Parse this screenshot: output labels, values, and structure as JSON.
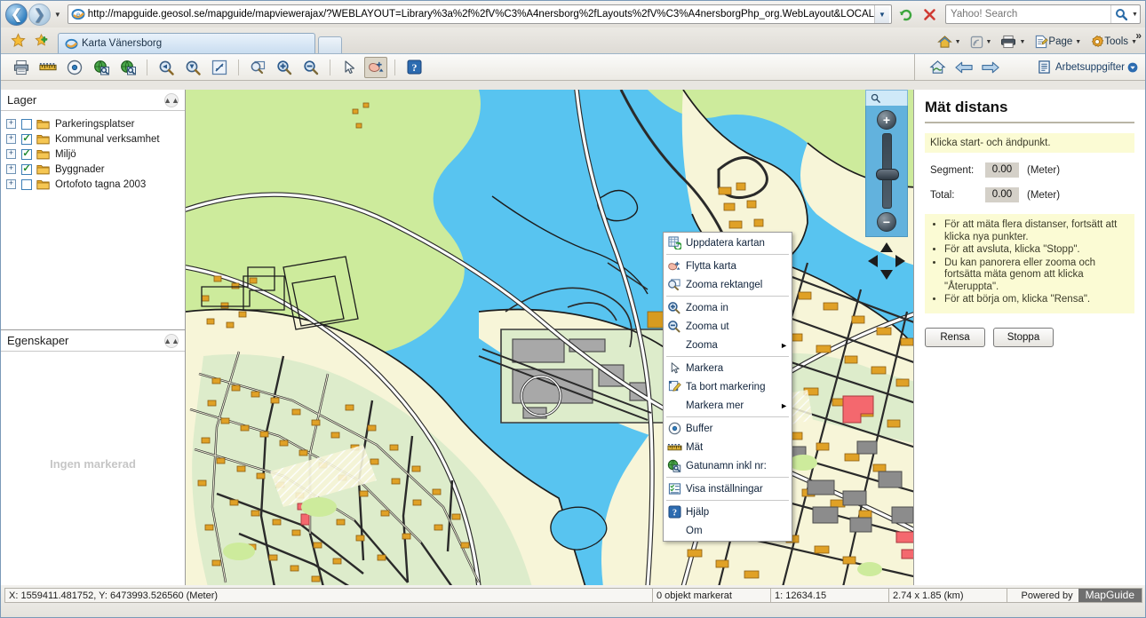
{
  "browser": {
    "url": "http://mapguide.geosol.se/mapguide/mapviewerajax/?WEBLAYOUT=Library%3a%2f%2fV%C3%A4nersborg%2fLayouts%2fV%C3%A4nersborgPhp_org.WebLayout&LOCALE=",
    "search_placeholder": "Yahoo! Search",
    "search_value": "",
    "tab_title": "Karta Vänersborg",
    "commands": [
      {
        "label": "Page",
        "icon": "page-icon"
      },
      {
        "label": "Tools",
        "icon": "gear-icon"
      }
    ],
    "icons": {
      "back": "back-arrow-icon",
      "forward": "forward-arrow-icon",
      "history": "history-dropdown-icon",
      "refresh": "refresh-icon",
      "stop": "stop-icon",
      "search_go": "search-icon",
      "favorites": "favorites-star-icon",
      "add_favorite": "add-favorite-icon",
      "home": "home-icon",
      "feeds": "feeds-icon",
      "print": "print-icon",
      "overflow": "overflow-chevrons-icon"
    }
  },
  "app_toolbar": {
    "tools": [
      {
        "name": "print-tool",
        "icon": "printer-icon",
        "active": false
      },
      {
        "name": "measure-tool",
        "icon": "ruler-icon",
        "active": false
      },
      {
        "name": "buffer-tool",
        "icon": "buffer-circle-icon",
        "active": false
      },
      {
        "name": "street-search-tool",
        "icon": "globe-search-icon",
        "active": false
      },
      {
        "name": "address-search-tool",
        "icon": "globe-search2-icon",
        "active": false
      },
      {
        "name": "zoom-previous-tool",
        "icon": "zoom-prev-icon",
        "active": false
      },
      {
        "name": "zoom-next-tool",
        "icon": "zoom-next-icon",
        "active": false
      },
      {
        "name": "zoom-extent-tool",
        "icon": "zoom-extent-icon",
        "active": false
      },
      {
        "name": "zoom-rectangle-tool",
        "icon": "zoom-rectangle-icon",
        "active": false
      },
      {
        "name": "zoom-in-tool",
        "icon": "zoom-in-icon",
        "active": false
      },
      {
        "name": "zoom-out-tool",
        "icon": "zoom-out-icon",
        "active": false
      },
      {
        "name": "select-tool",
        "icon": "arrow-select-icon",
        "active": false
      },
      {
        "name": "pan-tool",
        "icon": "pan-hand-icon",
        "active": true
      },
      {
        "name": "help-tool",
        "icon": "help-question-icon",
        "active": false
      }
    ],
    "right": {
      "home_icon": "home-map-icon",
      "prev_icon": "left-arrow-icon",
      "next_icon": "right-arrow-icon",
      "tasks_label": "Arbetsuppgifter",
      "tasks_icon": "tasks-list-icon",
      "tasks_caret": "chevron-down-icon"
    }
  },
  "legend": {
    "title": "Lager",
    "collapse_icon": "collapse-chevrons-icon",
    "layers": [
      {
        "label": "Parkeringsplatser",
        "checked": false
      },
      {
        "label": "Kommunal verksamhet",
        "checked": true
      },
      {
        "label": "Miljö",
        "checked": true
      },
      {
        "label": "Byggnader",
        "checked": true
      },
      {
        "label": "Ortofoto tagna 2003",
        "checked": false
      }
    ]
  },
  "properties": {
    "title": "Egenskaper",
    "collapse_icon": "collapse-chevrons-icon",
    "empty_text": "Ingen markerad"
  },
  "context_menu": {
    "items": [
      {
        "label": "Uppdatera kartan",
        "icon": "refresh-map-icon",
        "submenu": false,
        "sep_after": true
      },
      {
        "label": "Flytta karta",
        "icon": "pan-hand-icon",
        "submenu": false,
        "sep_after": false
      },
      {
        "label": "Zooma rektangel",
        "icon": "zoom-rectangle-icon",
        "submenu": false,
        "sep_after": true
      },
      {
        "label": "Zooma in",
        "icon": "zoom-in-icon",
        "submenu": false,
        "sep_after": false
      },
      {
        "label": "Zooma ut",
        "icon": "zoom-out-icon",
        "submenu": false,
        "sep_after": false
      },
      {
        "label": "Zooma",
        "icon": "",
        "submenu": true,
        "sep_after": true
      },
      {
        "label": "Markera",
        "icon": "arrow-select-icon",
        "submenu": false,
        "sep_after": false
      },
      {
        "label": "Ta bort markering",
        "icon": "clear-selection-icon",
        "submenu": false,
        "sep_after": false
      },
      {
        "label": "Markera mer",
        "icon": "",
        "submenu": true,
        "sep_after": true
      },
      {
        "label": "Buffer",
        "icon": "buffer-circle-icon",
        "submenu": false,
        "sep_after": false
      },
      {
        "label": "Mät",
        "icon": "ruler-icon",
        "submenu": false,
        "sep_after": false
      },
      {
        "label": "Gatunamn inkl nr:",
        "icon": "globe-search-icon",
        "submenu": false,
        "sep_after": true
      },
      {
        "label": "Visa inställningar",
        "icon": "settings-list-icon",
        "submenu": false,
        "sep_after": true
      },
      {
        "label": "Hjälp",
        "icon": "help-question-icon",
        "submenu": false,
        "sep_after": false
      },
      {
        "label": "Om",
        "icon": "",
        "submenu": false,
        "sep_after": false
      }
    ],
    "submenu_arrow": "right-triangle-icon"
  },
  "map_controls": {
    "search_icon": "magnifier-icon",
    "zoom_in_icon": "plus-icon",
    "zoom_out_icon": "minus-icon",
    "slider_name": "zoom-slider",
    "pan_pad_name": "pan-directional-pad"
  },
  "task_pane": {
    "title": "Mät distans",
    "hint": "Klicka start- och ändpunkt.",
    "fields": [
      {
        "label": "Segment:",
        "value": "0.00",
        "unit": "(Meter)"
      },
      {
        "label": "Total:",
        "value": "0.00",
        "unit": "(Meter)"
      }
    ],
    "tips": [
      "För att mäta flera distanser, fortsätt att klicka nya punkter.",
      "För att avsluta, klicka \"Stopp\".",
      "Du kan panorera eller zooma och fortsätta mäta genom att klicka \"Återuppta\".",
      "För att börja om, klicka \"Rensa\"."
    ],
    "buttons": [
      {
        "label": "Rensa",
        "name": "clear-button"
      },
      {
        "label": "Stoppa",
        "name": "stop-button"
      }
    ]
  },
  "status_bar": {
    "coordinates": "X: 1559411.481752, Y: 6473993.526560 (Meter)",
    "selection": "0 objekt markerat",
    "scale": "1: 12634.15",
    "extent": "2.74 x 1.85 (km)",
    "powered_by": "Powered by",
    "brand": "MapGuide"
  },
  "colors": {
    "water": "#58c4f0",
    "forest": "#cdeb9c",
    "land": "#f7f5d8",
    "residential": "#ddeccb",
    "building_orange": "#e0a126",
    "building_gray": "#8c8c8c",
    "building_red": "#f4686e",
    "road": "#ffffff",
    "hint_bg": "#fbfbd4",
    "brand_gray": "#6f6f6f"
  }
}
